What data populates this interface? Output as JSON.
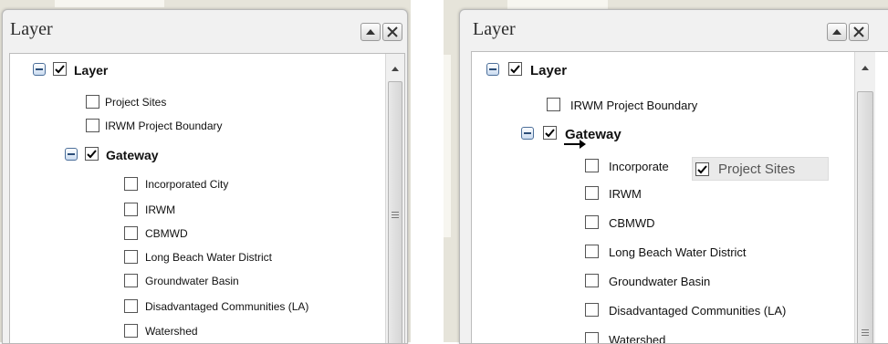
{
  "left_panel": {
    "title": "Layer",
    "root": {
      "label": "Layer",
      "checked": true
    },
    "items": [
      {
        "label": "Project Sites",
        "checked": false
      },
      {
        "label": "IRWM Project Boundary",
        "checked": false
      }
    ],
    "group": {
      "label": "Gateway",
      "checked": true
    },
    "group_items": [
      {
        "label": "Incorporated City",
        "checked": false
      },
      {
        "label": "IRWM",
        "checked": false
      },
      {
        "label": "CBMWD",
        "checked": false
      },
      {
        "label": "Long Beach Water District",
        "checked": false
      },
      {
        "label": "Groundwater Basin",
        "checked": false
      },
      {
        "label": "Disadvantaged Communities (LA)",
        "checked": false
      },
      {
        "label": "Watershed",
        "checked": false
      }
    ]
  },
  "right_panel": {
    "title": "Layer",
    "root": {
      "label": "Layer",
      "checked": true
    },
    "items": [
      {
        "label": "IRWM Project Boundary",
        "checked": false
      }
    ],
    "group": {
      "label": "Gateway",
      "checked": true
    },
    "group_items": [
      {
        "label": "Incorporate",
        "checked": false
      },
      {
        "label": "IRWM",
        "checked": false
      },
      {
        "label": "CBMWD",
        "checked": false
      },
      {
        "label": "Long Beach Water District",
        "checked": false
      },
      {
        "label": "Groundwater Basin",
        "checked": false
      },
      {
        "label": "Disadvantaged Communities (LA)",
        "checked": false
      },
      {
        "label": "Watershed",
        "checked": false
      }
    ],
    "drag_proxy": {
      "label": "Project Sites",
      "checked": true
    }
  },
  "icons": {
    "collapse": "collapse-up-icon",
    "close": "close-x-icon",
    "expand": "minus-box-icon",
    "check": "checkmark-icon",
    "drag": "drag-arrow-icon"
  }
}
